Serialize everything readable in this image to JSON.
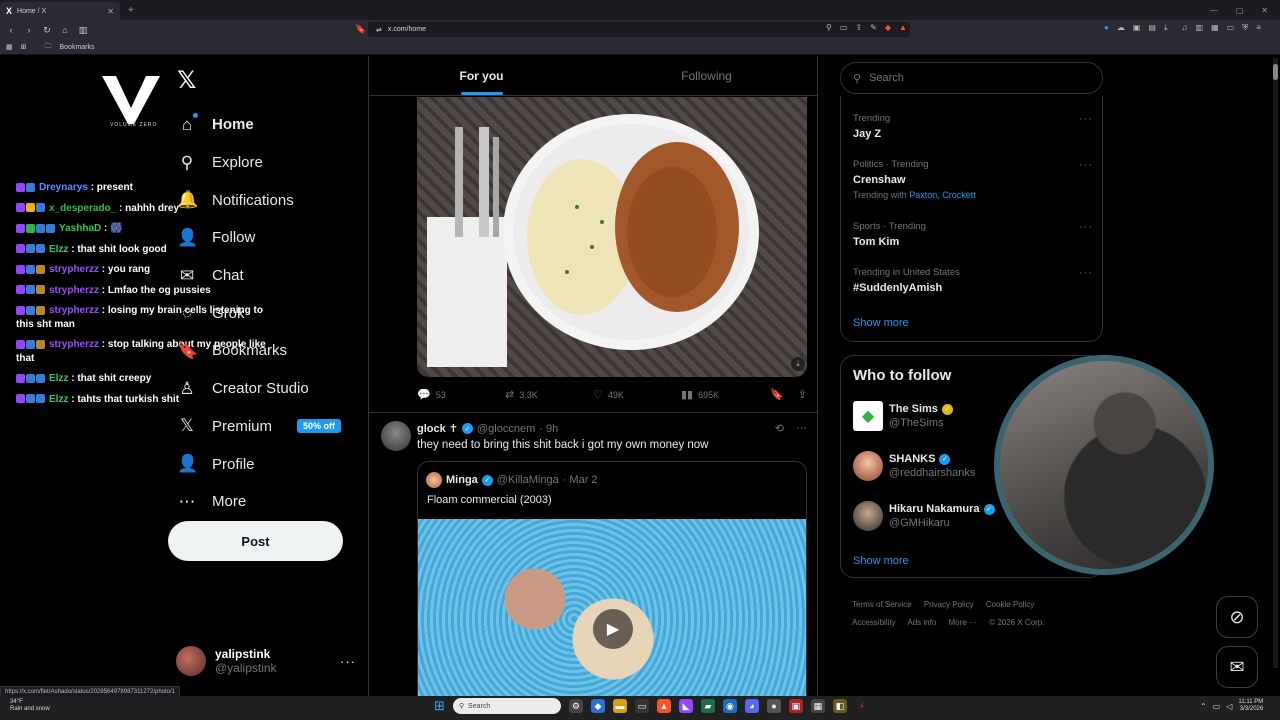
{
  "browser": {
    "tab_title": "Home / X",
    "tab_favicon": "X",
    "url": "x.com/home",
    "bookmarks_label": "Bookmarks",
    "status_url": "https://x.com/fletrAshado/status/2028564978987311272/photo/1"
  },
  "overlay": {
    "logo_text": "VOLUME ZERO",
    "chat": [
      {
        "badges": [
          "p",
          "b"
        ],
        "user": "Dreynarys",
        "color": "u1",
        "msg": ": present"
      },
      {
        "badges": [
          "p",
          "y",
          "b"
        ],
        "user": "x_desperado_",
        "color": "u2",
        "msg": ": nahhh drey"
      },
      {
        "badges": [
          "p",
          "g",
          "b",
          "b"
        ],
        "user": "YashhaD",
        "color": "u4",
        "msg": ": 🎆"
      },
      {
        "badges": [
          "p",
          "b",
          "b"
        ],
        "user": "Elzz",
        "color": "u4",
        "msg": ": that shit look good"
      },
      {
        "badges": [
          "p",
          "b",
          "o"
        ],
        "user": "strypherzz",
        "color": "u3",
        "msg": ": you rang"
      },
      {
        "badges": [
          "p",
          "b",
          "o"
        ],
        "user": "strypherzz",
        "color": "u3",
        "msg": ": Lmfao the og pussies"
      },
      {
        "badges": [
          "p",
          "b",
          "o"
        ],
        "user": "strypherzz",
        "color": "u3",
        "msg": ": losing my brain cells listening to this sht man"
      },
      {
        "badges": [
          "p",
          "b",
          "o"
        ],
        "user": "strypherzz",
        "color": "u3",
        "msg": ": stop talking about my people like that"
      },
      {
        "badges": [
          "p",
          "b",
          "b"
        ],
        "user": "Elzz",
        "color": "u4",
        "msg": ": that shit creepy"
      },
      {
        "badges": [
          "p",
          "b",
          "b"
        ],
        "user": "Elzz",
        "color": "u4",
        "msg": ": tahts that turkish shit"
      }
    ]
  },
  "nav": {
    "logo": "𝕏",
    "items": [
      {
        "name": "home",
        "icon": "⌂",
        "label": "Home",
        "active": true
      },
      {
        "name": "explore",
        "icon": "⚲",
        "label": "Explore"
      },
      {
        "name": "notifications",
        "icon": "🔔",
        "label": "Notifications"
      },
      {
        "name": "follow",
        "icon": "👤",
        "label": "Follow"
      },
      {
        "name": "chat",
        "icon": "✉",
        "label": "Chat"
      },
      {
        "name": "grok",
        "icon": "◌",
        "label": "Grok"
      },
      {
        "name": "bookmarks",
        "icon": "🔖",
        "label": "Bookmarks"
      },
      {
        "name": "creator-studio",
        "icon": "♙",
        "label": "Creator Studio"
      },
      {
        "name": "premium",
        "icon": "𝕏",
        "label": "Premium",
        "badge": "50% off"
      },
      {
        "name": "profile",
        "icon": "👤",
        "label": "Profile"
      },
      {
        "name": "more",
        "icon": "⋯",
        "label": "More"
      }
    ],
    "post_label": "Post",
    "account": {
      "name": "yalipstink",
      "handle": "@yalipstink",
      "more": "···"
    }
  },
  "feed": {
    "tabs": [
      "For you",
      "Following"
    ],
    "prev_post_actions": {
      "replies": "53",
      "reposts": "3.3K",
      "likes": "49K",
      "views": "695K"
    },
    "tweet": {
      "name": "glock ✝",
      "handle": "@gloccnem",
      "time": "· 9h",
      "text": "they need to bring this shit back i got my own money now",
      "quote": {
        "name": "Minga",
        "handle": "@KillaMinga",
        "time": "· Mar 2",
        "text": "Floam commercial (2003)"
      }
    }
  },
  "right": {
    "search_placeholder": "Search",
    "trends": [
      {
        "meta": "Trending",
        "topic": "Jay Z"
      },
      {
        "meta": "Politics · Trending",
        "topic": "Crenshaw",
        "with_label": "Trending with",
        "with": "Paxton, Crockett"
      },
      {
        "meta": "Sports · Trending",
        "topic": "Tom Kim"
      },
      {
        "meta": "Trending in United States",
        "topic": "#SuddenlyAmish"
      }
    ],
    "show_more": "Show more",
    "who_to_follow": {
      "title": "Who to follow",
      "items": [
        {
          "name": "The Sims",
          "handle": "@TheSims",
          "badge": "gold"
        },
        {
          "name": "SHANKS",
          "handle": "@reddhairshanks",
          "badge": "blue"
        },
        {
          "name": "Hikaru Nakamura",
          "handle": "@GMHikaru",
          "badge": "blue"
        }
      ],
      "show_more": "Show more"
    },
    "footer": [
      "Terms of Service",
      "Privacy Policy",
      "Cookie Policy",
      "Accessibility",
      "Ads info",
      "More ···",
      "© 2026 X Corp."
    ]
  },
  "taskbar": {
    "weather_temp": "34°F",
    "weather_desc": "Rain and snow",
    "search": "Search",
    "time": "11:11 PM",
    "date": "3/3/2026"
  },
  "colors": {
    "accent": "#1d9bf0",
    "background": "#000000",
    "border": "#2f3336"
  }
}
